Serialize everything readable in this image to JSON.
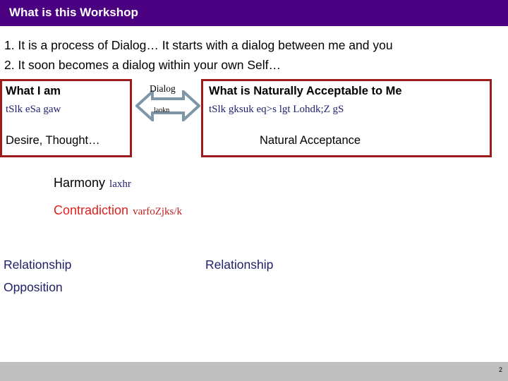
{
  "slide": {
    "title": "What is this Workshop",
    "bullets": [
      "1. It is a process of Dialog… It starts with a dialog between me and you",
      "2. It soon becomes a dialog within your own Self…"
    ],
    "left_box": {
      "heading": "What I am",
      "hindi": "tSlk eSa gaw",
      "footer": "Desire, Thought…"
    },
    "right_box": {
      "heading": "What is Naturally Acceptable to Me",
      "hindi": "tSlk gksuk eq>s lgt Lohdk;Z gS",
      "footer": "Natural Acceptance"
    },
    "dialog_arrow": {
      "label_en": "Dialog",
      "label_hi": "laokn"
    },
    "pairs": [
      {
        "en": "Harmony",
        "hi": "laxhr"
      },
      {
        "en": "Contradiction",
        "hi": "varfoZjks/k"
      }
    ],
    "relationship_left": "Relationship",
    "opposition_left": "Opposition",
    "relationship_right": "Relationship",
    "page_number": "2"
  },
  "colors": {
    "banner_purple": "#4a0080",
    "box_border_red": "#9e1b1b",
    "hindi_blue": "#1f1f6e",
    "contradiction_red": "#e02020",
    "relationship_navy": "#20206a",
    "arrow_slate": "#7d96a8",
    "bottom_bar_gray": "#bfbfbf"
  }
}
